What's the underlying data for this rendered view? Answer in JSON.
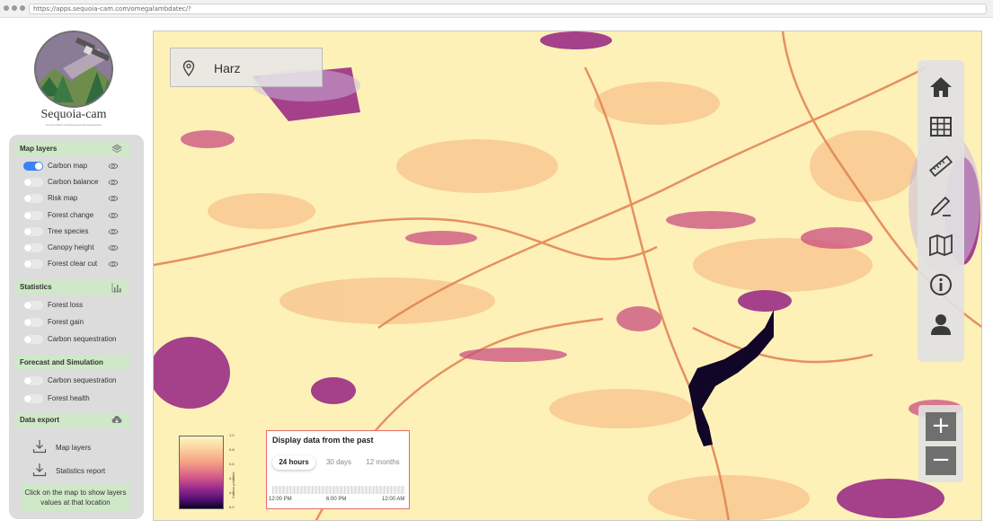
{
  "browser": {
    "url": "https://apps.sequoia-cam.com/omegalambdatec/?"
  },
  "brand": {
    "name": "Sequoia-cam",
    "tagline": "Forest carbon monitoring and risk assessment"
  },
  "sections": {
    "map_layers": {
      "title": "Map layers",
      "icon": "layers-icon"
    },
    "statistics": {
      "title": "Statistics",
      "icon": "bar-chart-icon"
    },
    "forecast": {
      "title": "Forecast and Simulation"
    },
    "export": {
      "title": "Data export",
      "icon": "cloud-download-icon"
    }
  },
  "layers": [
    {
      "label": "Carbon map",
      "on": true
    },
    {
      "label": "Carbon balance",
      "on": false
    },
    {
      "label": "Risk map",
      "on": false
    },
    {
      "label": "Forest change",
      "on": false
    },
    {
      "label": "Tree species",
      "on": false
    },
    {
      "label": "Canopy height",
      "on": false
    },
    {
      "label": "Forest clear cut",
      "on": false
    }
  ],
  "statistics": [
    {
      "label": "Forest loss",
      "on": false
    },
    {
      "label": "Forest gain",
      "on": false
    },
    {
      "label": "Carbon sequestration",
      "on": false
    }
  ],
  "forecast": [
    {
      "label": "Carbon sequestration",
      "on": false
    },
    {
      "label": "Forest health",
      "on": false
    }
  ],
  "export": [
    {
      "label": "Map layers"
    },
    {
      "label": "Statistics report"
    }
  ],
  "hint": "Click on the map to show layers values at that location",
  "map": {
    "location": "Harz"
  },
  "toolbar": [
    "home-icon",
    "grid-icon",
    "ruler-icon",
    "pencil-icon",
    "map-icon",
    "info-icon",
    "user-icon"
  ],
  "zoom": {
    "in": "+",
    "out": "−"
  },
  "legend": {
    "ticks": [
      "1.0",
      "0.8",
      "0.6",
      "0.4",
      "0.2",
      "0.0"
    ],
    "caption": "Carbon potential"
  },
  "time_panel": {
    "title": "Display data from the past",
    "tabs": [
      "24 hours",
      "30 days",
      "12 months"
    ],
    "active_tab": "24 hours",
    "labels": [
      "12:00 PM",
      "6:00 PM",
      "12:00 AM"
    ]
  },
  "colors": {
    "toggle_on": "#3b82f6",
    "section_bg": "#cfe8c7",
    "panel_bg": "#dcdcdc",
    "map_low": "#fdf1b8",
    "map_high": "#0b0322"
  }
}
